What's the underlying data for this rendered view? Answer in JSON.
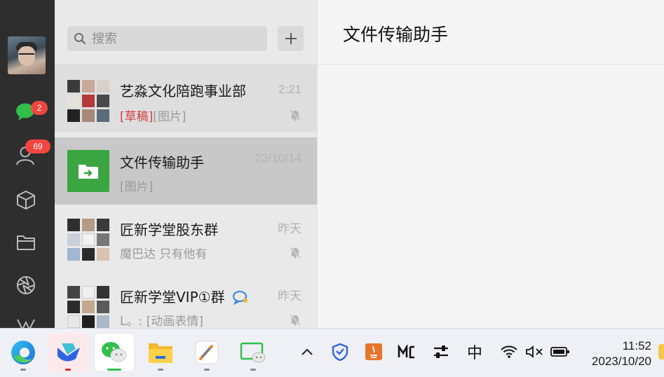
{
  "nav": {
    "chats_badge": "2",
    "contacts_badge": "69"
  },
  "search": {
    "placeholder": "搜索"
  },
  "chats": [
    {
      "name": "艺淼文化陪跑事业部",
      "draft": "[草稿]",
      "preview": "[图片]",
      "time": "2:21",
      "muted": true
    },
    {
      "name": "文件传输助手",
      "draft": "",
      "preview": "[图片]",
      "time": "23/10/14",
      "muted": false,
      "selected": true
    },
    {
      "name": "匠新学堂股东群",
      "draft": "",
      "preview": "魔巴达 只有他有",
      "time": "昨天",
      "muted": true
    },
    {
      "name": "匠新学堂VIP①群",
      "draft": "",
      "preview": "L。: [动画表情]",
      "time": "昨天",
      "muted": true
    }
  ],
  "main": {
    "title": "文件传输助手"
  },
  "taskbar": {
    "ime": "中",
    "time": "11:52",
    "date": "2023/10/20"
  },
  "colors": {
    "wechat_green": "#3aa541",
    "badge_red": "#f0463f",
    "draft_red": "#d23c3c"
  }
}
